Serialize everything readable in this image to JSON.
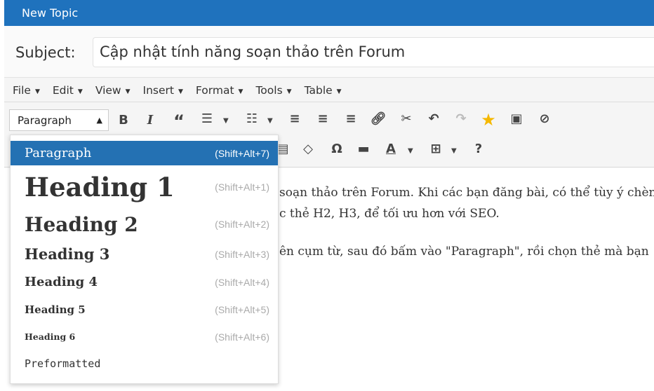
{
  "window": {
    "title": "New Topic"
  },
  "subject": {
    "label": "Subject:",
    "value": "Cập nhật tính năng soạn thảo trên Forum"
  },
  "menubar": [
    "File",
    "Edit",
    "View",
    "Insert",
    "Format",
    "Tools",
    "Table"
  ],
  "toolbar": {
    "format_select": "Paragraph",
    "accent_color": "#1f72bd",
    "star_color": "#f5b800"
  },
  "content": {
    "lines": [
      "soạn thảo trên Forum. Khi các bạn đăng bài, có thể tùy ý chèn",
      "c thẻ H2, H3, để tối ưu hơn với SEO.",
      "ên cụm từ, sau đó bấm vào \"Paragraph\", rồi chọn thẻ mà bạn"
    ]
  },
  "dropdown": {
    "items": [
      {
        "label": "Paragraph",
        "shortcut": "(Shift+Alt+7)"
      },
      {
        "label": "Heading 1",
        "shortcut": "(Shift+Alt+1)"
      },
      {
        "label": "Heading 2",
        "shortcut": "(Shift+Alt+2)"
      },
      {
        "label": "Heading 3",
        "shortcut": "(Shift+Alt+3)"
      },
      {
        "label": "Heading 4",
        "shortcut": "(Shift+Alt+4)"
      },
      {
        "label": "Heading 5",
        "shortcut": "(Shift+Alt+5)"
      },
      {
        "label": "Heading 6",
        "shortcut": "(Shift+Alt+6)"
      },
      {
        "label": "Preformatted"
      }
    ]
  }
}
